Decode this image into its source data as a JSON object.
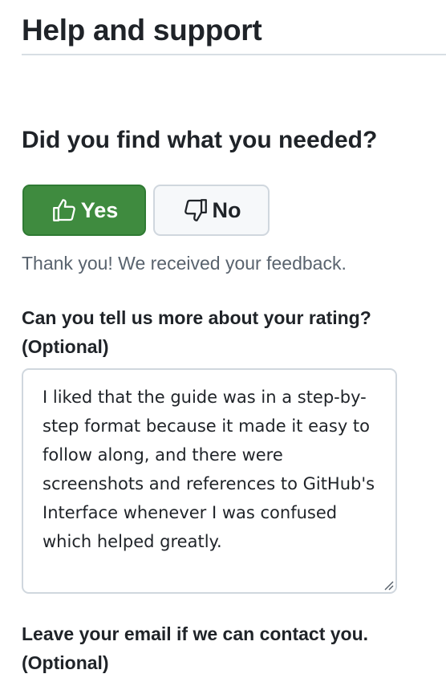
{
  "page": {
    "title": "Help and support"
  },
  "feedback": {
    "question": "Did you find what you needed?",
    "yes_label": "Yes",
    "no_label": "No",
    "yes_icon": "thumbs-up-icon",
    "no_icon": "thumbs-down-icon",
    "thanks_message": "Thank you! We received your feedback.",
    "rating_label_line1": "Can you tell us more about your rating?",
    "rating_label_line2": "(Optional)",
    "rating_value": "I liked that the guide was in a step-by-step format because it made it easy to follow along, and there were screenshots and references to GitHub's Interface whenever I was confused which helped greatly.",
    "email_label_line1": "Leave your email if we can contact you.",
    "email_label_line2": "(Optional)"
  },
  "colors": {
    "yes_button_bg": "#3f8b3f",
    "no_button_bg": "#f6f8fa",
    "muted_text": "#59636e"
  }
}
